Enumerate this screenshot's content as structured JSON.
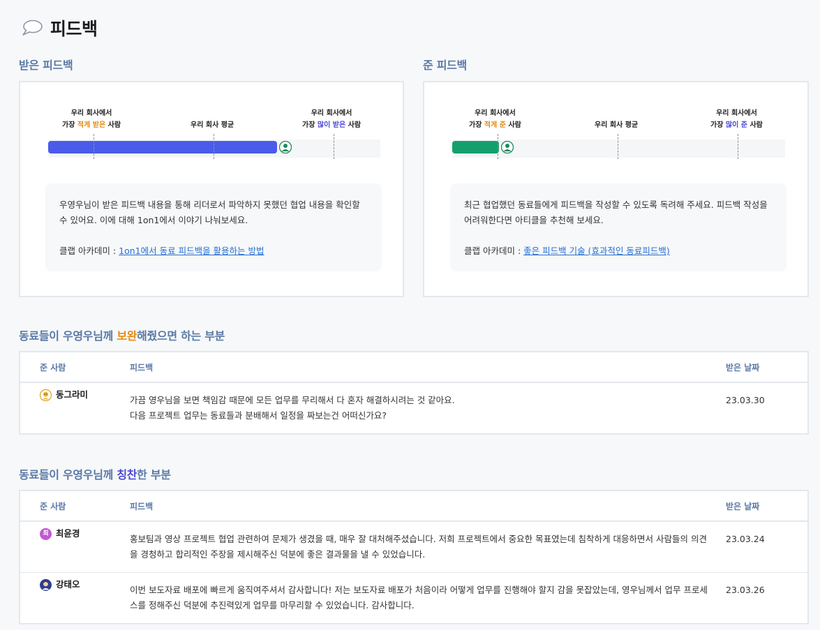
{
  "header": {
    "title": "피드백",
    "icon": "speech-bubble-icon"
  },
  "received": {
    "title": "받은 피드백",
    "marker_low_line1": "우리 회사에서",
    "marker_low_pre": "가장 ",
    "marker_low_hl": "적게 받은",
    "marker_low_post": " 사람",
    "marker_avg": "우리 회사 평균",
    "marker_high_line1": "우리 회사에서",
    "marker_high_pre": "가장 ",
    "marker_high_hl": "많이 받은",
    "marker_high_post": " 사람",
    "level": 0.69,
    "bar_color": "#4a5bea",
    "desc": "우영우님이 받은 피드백 내용을 통해 리더로서 파악하지 못했던 협업 내용을 확인할 수 있어요. 이에 대해 1on1에서 이야기 나눠보세요.",
    "academy_label": "클랩 아카데미 : ",
    "academy_link": "1on1에서 동료 피드백을 활용하는 방법"
  },
  "given": {
    "title": "준 피드백",
    "marker_low_line1": "우리 회사에서",
    "marker_low_pre": "가장 ",
    "marker_low_hl": "적게 준",
    "marker_low_post": " 사람",
    "marker_avg": "우리 회사 평균",
    "marker_high_line1": "우리 회사에서",
    "marker_high_pre": "가장 ",
    "marker_high_hl": "많이 준",
    "marker_high_post": " 사람",
    "level": 0.14,
    "bar_color": "#14a06c",
    "desc": "최근 협업했던 동료들에게 피드백을 작성할 수 있도록 독려해 주세요. 피드백 작성을 어려워한다면 아티클을 추천해 보세요.",
    "academy_label": "클랩 아카데미 : ",
    "academy_link": "좋은 피드백 기술 (효과적인 동료피드백)"
  },
  "improve": {
    "title_pre": "동료들이 우영우님께 ",
    "title_hl": "보완",
    "title_post": "해줬으면 하는 부분",
    "headers": {
      "giver": "준 사람",
      "feedback": "피드백",
      "date": "받은 날짜"
    },
    "rows": [
      {
        "giver": "동그라미",
        "avatar_color": "#f2b632",
        "text_line1": "가끔 영우님을 보면 책임감 때문에 모든 업무를 무리해서 다 혼자 해결하시려는 것 같아요.",
        "text_line2": "다음 프로젝트 업무는 동료들과 분배해서 일정을 짜보는건 어떠신가요?",
        "date": "23.03.30"
      }
    ]
  },
  "praise": {
    "title_pre": "동료들이 우영우님께 ",
    "title_hl": "칭찬",
    "title_post": "한 부분",
    "headers": {
      "giver": "준 사람",
      "feedback": "피드백",
      "date": "받은 날짜"
    },
    "rows": [
      {
        "giver": "최윤경",
        "avatar_text": "최",
        "avatar_color": "#c05ad1",
        "text": "홍보팀과 영상 프로젝트 협업 관련하여 문제가 생겼을 때, 매우 잘 대처해주셨습니다. 저희 프로젝트에서 중요한 목표였는데 침착하게 대응하면서 사람들의 의견을 경청하고 합리적인 주장을 제시해주신 덕분에 좋은 결과물을 낼 수 있었습니다.",
        "date": "23.03.24"
      },
      {
        "giver": "강태오",
        "avatar_color": "#2e3f8f",
        "text": "이번 보도자료 배포에 빠르게 움직여주셔서 감사합니다! 저는 보도자료 배포가 처음이라 어떻게 업무를 진행해야 할지 감을 못잡았는데, 영우님께서 업무 프로세스를 정해주신 덕분에 추진력있게 업무를 마무리할 수 있었습니다. 감사합니다.",
        "date": "23.03.26"
      }
    ]
  }
}
